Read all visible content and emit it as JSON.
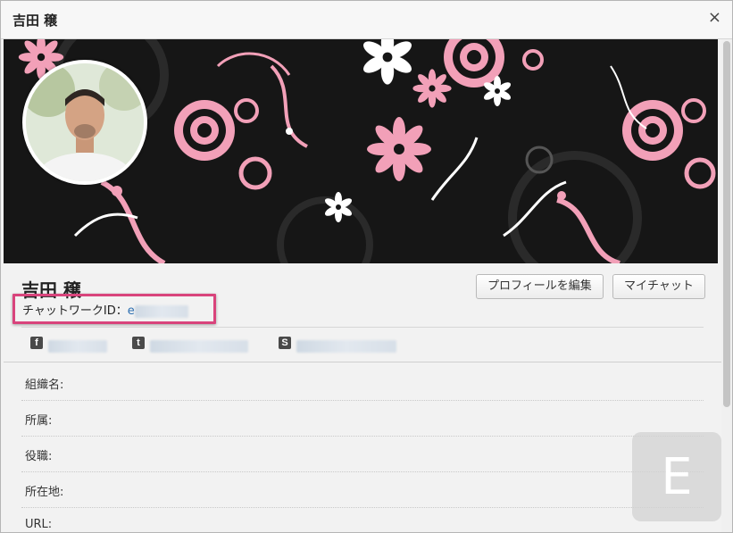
{
  "dialog": {
    "title": "吉田 穣",
    "close_label": "×"
  },
  "profile": {
    "name": "吉田 穣",
    "chatwork_id_label": "チャットワークID：",
    "chatwork_id_value": "e",
    "edit_button": "プロフィールを編集",
    "chat_button": "マイチャット"
  },
  "social": [
    {
      "icon": "facebook-icon",
      "glyph": "f"
    },
    {
      "icon": "twitter-icon",
      "glyph": "t"
    },
    {
      "icon": "skype-icon",
      "glyph": "S"
    }
  ],
  "fields": [
    {
      "label": "組織名:"
    },
    {
      "label": "所属:"
    },
    {
      "label": "役職:"
    },
    {
      "label": "所在地:"
    },
    {
      "label": "URL:"
    }
  ],
  "watermark": {
    "letter": "E"
  },
  "colors": {
    "highlight": "#d9447c",
    "cover_background": "#161616",
    "cover_pink": "#f2a0b8",
    "link": "#2a6db0"
  }
}
